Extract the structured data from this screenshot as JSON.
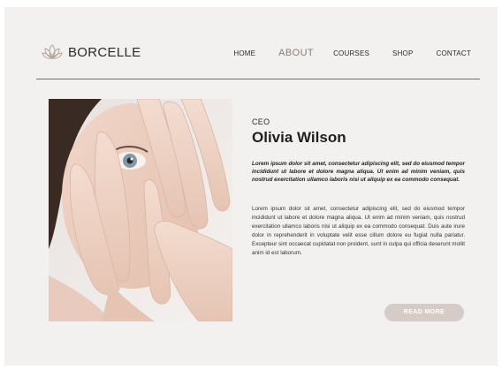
{
  "brand": {
    "name": "BORCELLE",
    "icon": "lotus-icon"
  },
  "nav": {
    "items": [
      {
        "label": "HOME",
        "active": false
      },
      {
        "label": "ABOUT",
        "active": true
      },
      {
        "label": "COURSES",
        "active": false
      },
      {
        "label": "SHOP",
        "active": false
      },
      {
        "label": "CONTACT",
        "active": false
      }
    ]
  },
  "profile": {
    "role": "CEO",
    "name": "Olivia Wilson",
    "lead": "Lorem ipsum dolor sit amet, consectetur adipiscing elit, sed do eiusmod tempor incididunt ut labore et dolore magna aliqua. Ut enim ad minim veniam, quis nostrud exercitation ullamco laboris nisi ut aliquip ex ea commodo consequat.",
    "body": "Lorem ipsum dolor sit amet, consectetur adipiscing elit, sed do eiusmod tempor incididunt ut labore et dolore magna aliqua. Ut enim ad minim veniam, quis nostrud exercitation ullamco laboris nisi ut aliquip ex ea commodo consequat. Duis aute irure dolor in reprehenderit in voluptate velit esse cillum dolore eu fugiat nulla pariatur. Excepteur sint occaecat cupidatat non proident, sunt in culpa qui officia deserunt mollit anim id est laborum.",
    "button_label": "READ MORE"
  },
  "colors": {
    "background": "#f3f1ef",
    "accent": "#8b7b6f",
    "button": "#d6ccc5",
    "text": "#1f1f1f"
  }
}
